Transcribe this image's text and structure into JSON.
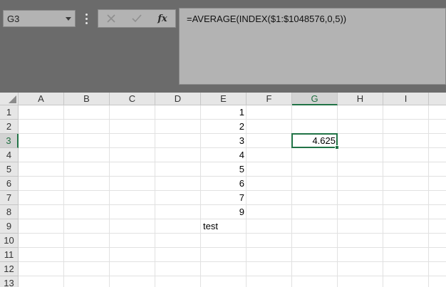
{
  "name_box": {
    "value": "G3"
  },
  "formula_bar": {
    "formula": "=AVERAGE(INDEX($1:$1048576,0,5))",
    "insert_function_label": "fx"
  },
  "sheet": {
    "columns": [
      "A",
      "B",
      "C",
      "D",
      "E",
      "F",
      "G",
      "H",
      "I"
    ],
    "rows": [
      "1",
      "2",
      "3",
      "4",
      "5",
      "6",
      "7",
      "8",
      "9",
      "10",
      "11",
      "12",
      "13"
    ],
    "active_cell": {
      "col": "G",
      "row": "3"
    },
    "cells": [
      {
        "ref": "E1",
        "col": "E",
        "row": "1",
        "value": "1",
        "type": "number"
      },
      {
        "ref": "E2",
        "col": "E",
        "row": "2",
        "value": "2",
        "type": "number"
      },
      {
        "ref": "E3",
        "col": "E",
        "row": "3",
        "value": "3",
        "type": "number"
      },
      {
        "ref": "E4",
        "col": "E",
        "row": "4",
        "value": "4",
        "type": "number"
      },
      {
        "ref": "E5",
        "col": "E",
        "row": "5",
        "value": "5",
        "type": "number"
      },
      {
        "ref": "E6",
        "col": "E",
        "row": "6",
        "value": "6",
        "type": "number"
      },
      {
        "ref": "E7",
        "col": "E",
        "row": "7",
        "value": "7",
        "type": "number"
      },
      {
        "ref": "E8",
        "col": "E",
        "row": "8",
        "value": "9",
        "type": "number"
      },
      {
        "ref": "E9",
        "col": "E",
        "row": "9",
        "value": "test",
        "type": "text"
      },
      {
        "ref": "G3",
        "col": "G",
        "row": "3",
        "value": "4.625",
        "type": "number"
      }
    ]
  },
  "colors": {
    "accent": "#217346",
    "ribbon_bg": "#6b6b6b",
    "box_bg": "#b3b3b3",
    "header_bg": "#e6e6e6"
  },
  "icons": {
    "cancel": "cancel-icon",
    "enter": "enter-icon",
    "options": "more-options-icon",
    "dropdown": "chevron-down-icon",
    "select_all": "select-all-icon"
  }
}
